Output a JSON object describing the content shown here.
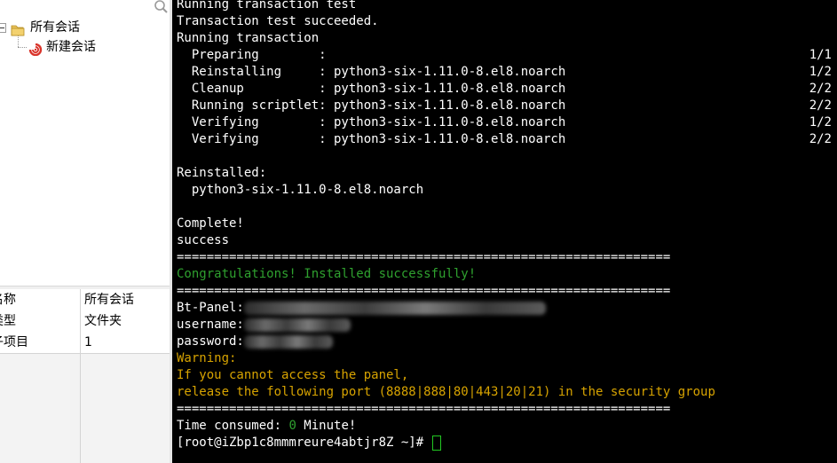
{
  "tree": {
    "root_label": "所有会话",
    "child_label": "新建会话"
  },
  "properties": [
    {
      "key": "名称",
      "value": "所有会话"
    },
    {
      "key": "类型",
      "value": "文件夹"
    },
    {
      "key": "子项目",
      "value": "1"
    }
  ],
  "terminal": {
    "l1": "Running transaction test",
    "l2": "Transaction test succeeded.",
    "l3": "Running transaction",
    "steps": [
      {
        "text": "  Preparing        :",
        "count": "1/1"
      },
      {
        "text": "  Reinstalling     : python3-six-1.11.0-8.el8.noarch",
        "count": "1/2"
      },
      {
        "text": "  Cleanup          : python3-six-1.11.0-8.el8.noarch",
        "count": "2/2"
      },
      {
        "text": "  Running scriptlet: python3-six-1.11.0-8.el8.noarch",
        "count": "2/2"
      },
      {
        "text": "  Verifying        : python3-six-1.11.0-8.el8.noarch",
        "count": "1/2"
      },
      {
        "text": "  Verifying        : python3-six-1.11.0-8.el8.noarch",
        "count": "2/2"
      }
    ],
    "reinstalled_header": "Reinstalled:",
    "reinstalled_pkg": "  python3-six-1.11.0-8.el8.noarch",
    "complete": "Complete!",
    "success": "success",
    "separator": "==================================================================",
    "congrats": "Congratulations! Installed successfully!",
    "panel_label": "Bt-Panel:",
    "username_label": "username:",
    "password_label": "password:",
    "warning": "Warning:",
    "warn_line1": "If you cannot access the panel,",
    "warn_line2": "release the following port (8888|888|80|443|20|21) in the security group",
    "time_prefix": "Time consumed: ",
    "time_value": "0",
    "time_suffix": " Minute!",
    "prompt": "[root@iZbp1c8mmmreure4abtjr8Z ~]# "
  },
  "colors": {
    "terminal_bg": "#000000",
    "terminal_fg": "#ffffff",
    "success_green": "#2fa12f",
    "warning_yellow": "#d7a300",
    "cursor_green": "#22c722"
  }
}
